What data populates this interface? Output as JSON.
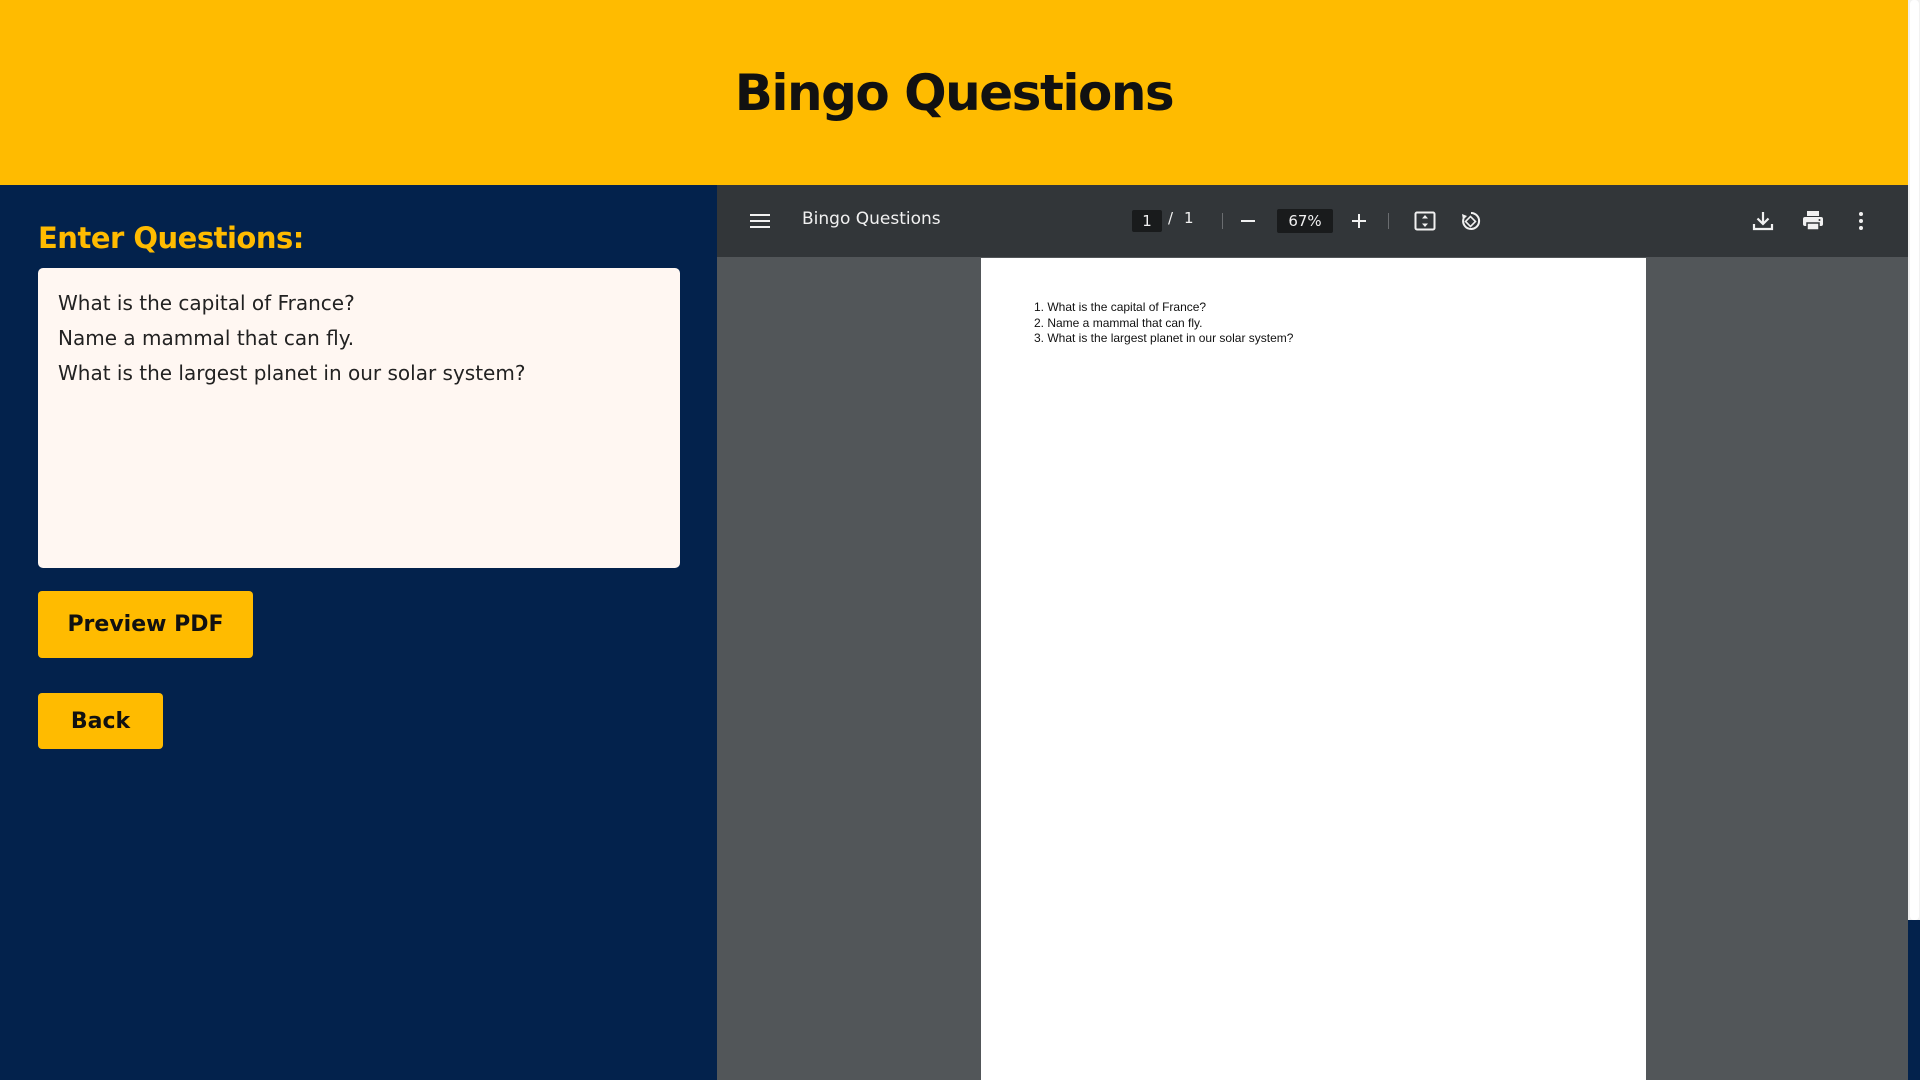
{
  "header": {
    "title": "Bingo Questions"
  },
  "left_panel": {
    "heading": "Enter Questions:",
    "questions": [
      "What is the capital of France?",
      "Name a mammal that can fly.",
      "What is the largest planet in our solar system?"
    ],
    "preview_button": "Preview PDF",
    "back_button": "Back"
  },
  "pdf_viewer": {
    "document_title": "Bingo Questions",
    "current_page": "1",
    "page_separator": "/",
    "total_pages": "1",
    "zoom": "67%",
    "icons": {
      "menu": "menu-icon",
      "zoom_out": "minus-icon",
      "zoom_in": "plus-icon",
      "fit": "fit-page-icon",
      "rotate": "rotate-icon",
      "download": "download-icon",
      "print": "print-icon",
      "more": "more-vert-icon"
    },
    "page_content": [
      "1. What is the capital of France?",
      "2. Name a mammal that can fly.",
      "3. What is the largest planet in our solar system?"
    ]
  },
  "colors": {
    "accent_yellow": "#FFBB00",
    "navy": "#03224C",
    "textarea_bg": "#FFF7F2",
    "viewer_bg": "#525659",
    "viewer_toolbar": "#323639"
  }
}
